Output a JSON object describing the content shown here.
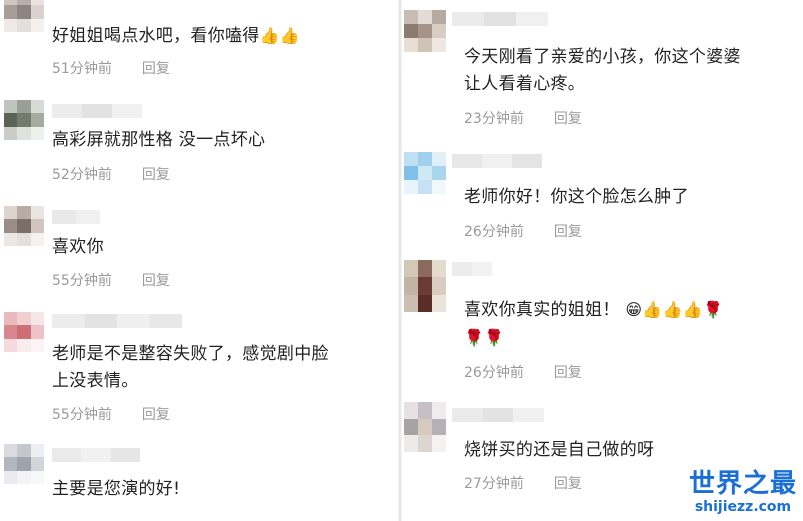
{
  "left_comments": [
    {
      "text": "好姐姐喝点水吧，看你嗑得",
      "emojis": "👍👍",
      "time": "51分钟前",
      "reply": "回复"
    },
    {
      "text": "高彩屏就那性格 没一点坏心",
      "time": "52分钟前",
      "reply": "回复"
    },
    {
      "text": "喜欢你",
      "time": "55分钟前",
      "reply": "回复"
    },
    {
      "text": "老师是不是整容失败了，感觉剧中脸",
      "text2": "上没表情。",
      "time": "55分钟前",
      "reply": "回复"
    },
    {
      "text": "主要是您演的好!"
    }
  ],
  "right_comments": [
    {
      "text": "今天刚看了亲爱的小孩，你这个婆婆",
      "text2": "让人看着心疼。",
      "time": "23分钟前",
      "reply": "回复"
    },
    {
      "text": "老师你好！你这个脸怎么肿了",
      "time": "26分钟前",
      "reply": "回复"
    },
    {
      "text": "喜欢你真实的姐姐！",
      "emojis": "😁👍👍👍🌹",
      "emojis2": "🌹🌹",
      "time": "26分钟前",
      "reply": "回复"
    },
    {
      "text": "烧饼买的还是自己做的呀",
      "time": "27分钟前",
      "reply": "回复"
    }
  ],
  "watermark": {
    "title": "世界之最",
    "url": "shijiezz.com"
  }
}
